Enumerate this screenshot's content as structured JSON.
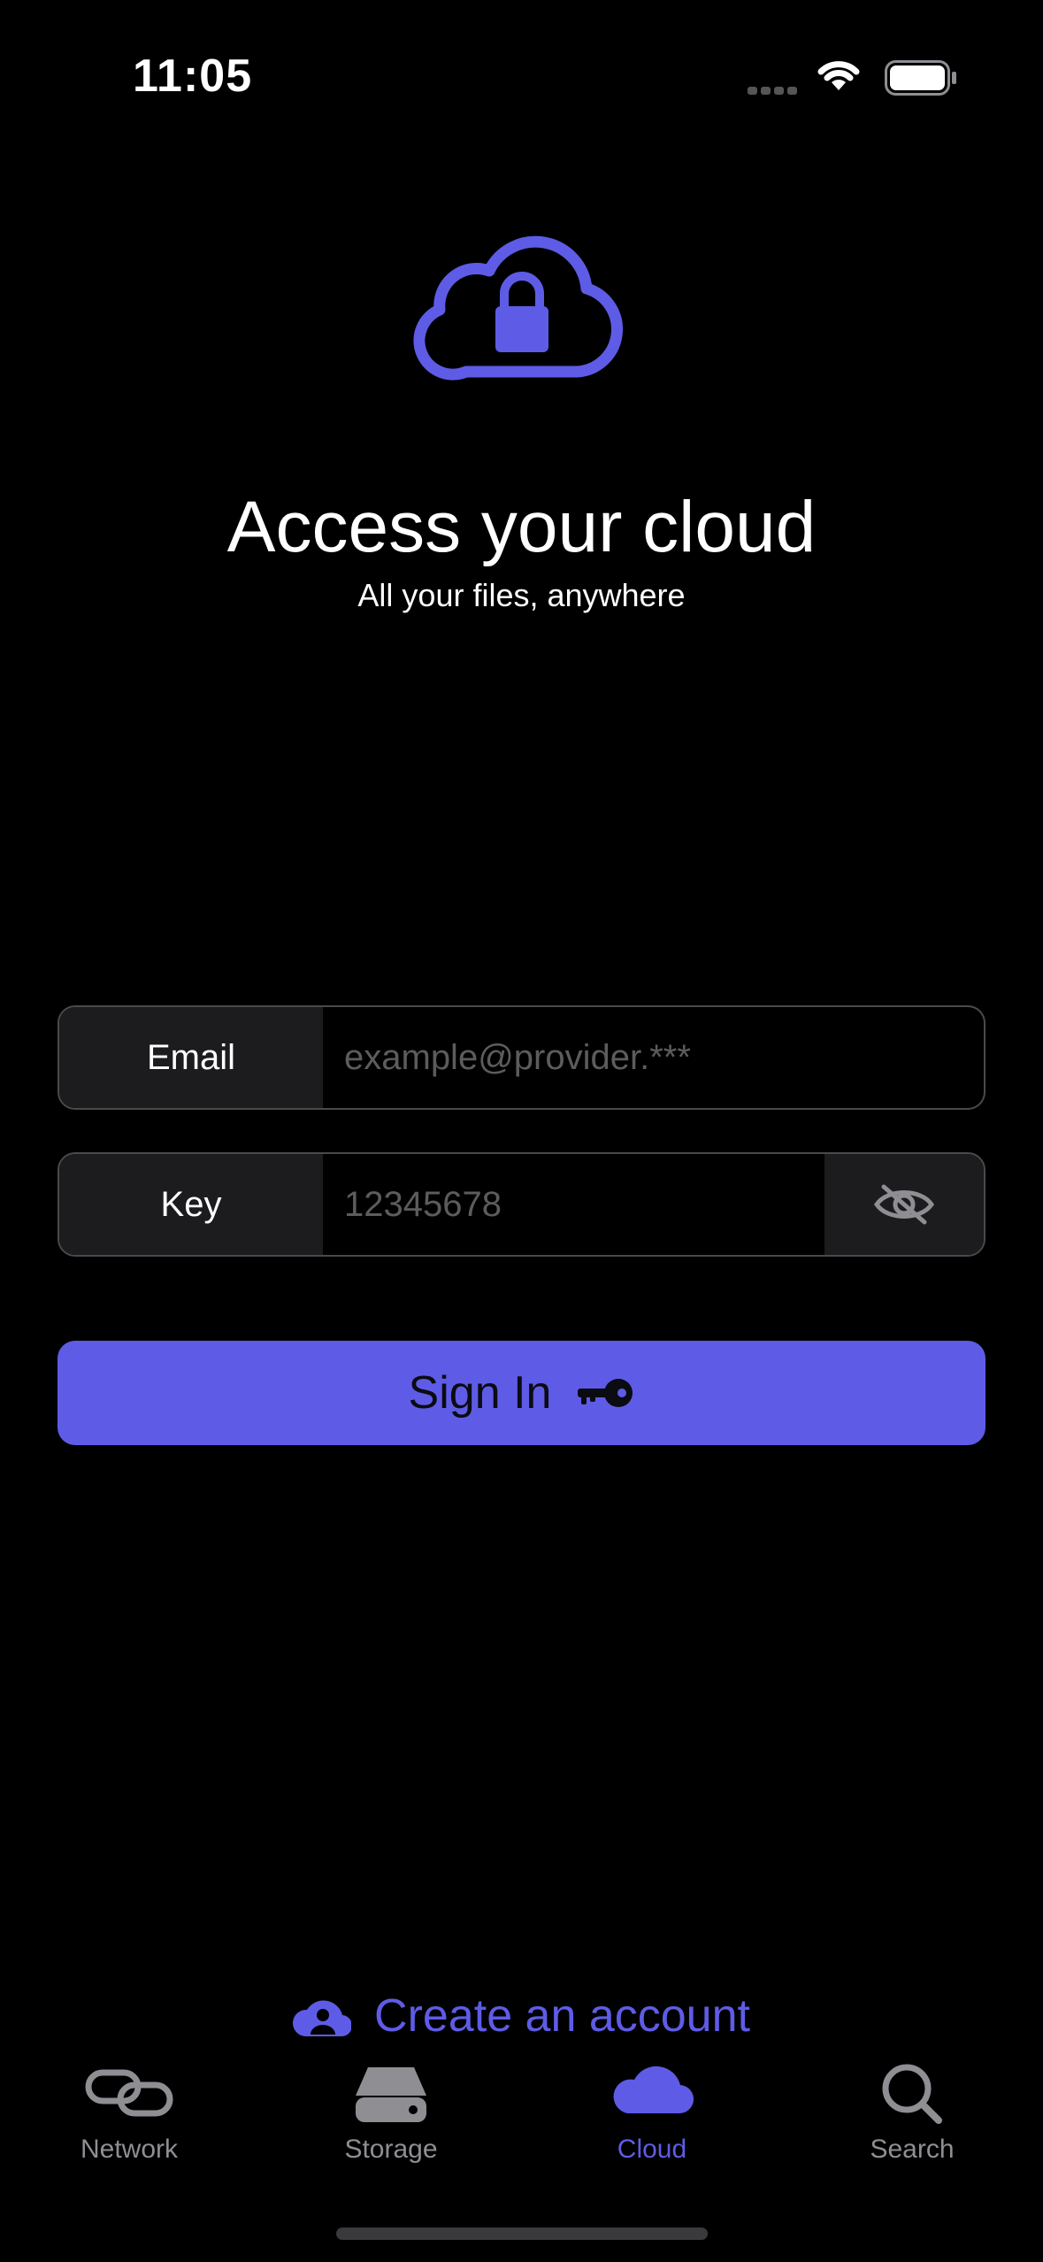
{
  "status_bar": {
    "time": "11:05"
  },
  "hero": {
    "icon": "cloud-lock-icon",
    "title": "Access your cloud",
    "subtitle": "All your files, anywhere"
  },
  "form": {
    "email_label": "Email",
    "email_placeholder": "example@provider.***",
    "email_value": "",
    "key_label": "Key",
    "key_placeholder": "12345678",
    "key_value": "",
    "visibility_icon": "eye-slash-icon",
    "signin_label": "Sign In",
    "signin_icon": "key-icon"
  },
  "create_account": {
    "label": "Create an account",
    "icon": "person-cloud-icon"
  },
  "tab_bar": {
    "tabs": [
      {
        "label": "Network",
        "icon": "link-icon",
        "active": false
      },
      {
        "label": "Storage",
        "icon": "drive-icon",
        "active": false
      },
      {
        "label": "Cloud",
        "icon": "cloud-icon",
        "active": true
      },
      {
        "label": "Search",
        "icon": "magnifying-glass-icon",
        "active": false
      }
    ]
  },
  "colors": {
    "accent": "#5e5ce6",
    "background": "#000000",
    "field_label_bg": "#1c1c1e",
    "inactive_tab": "#8e8e93"
  }
}
